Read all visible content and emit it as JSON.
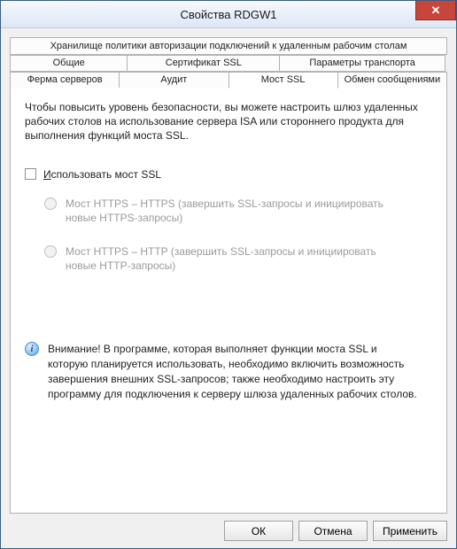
{
  "window": {
    "title": "Свойства RDGW1",
    "close_glyph": "✕"
  },
  "tabs": {
    "row1": [
      "Хранилище политики авторизации подключений к удаленным рабочим столам"
    ],
    "row2": [
      "Общие",
      "Сертификат SSL",
      "Параметры транспорта"
    ],
    "row3": [
      "Ферма серверов",
      "Аудит",
      "Мост SSL",
      "Обмен сообщениями"
    ],
    "active": "Мост SSL"
  },
  "panel": {
    "intro": "Чтобы повысить уровень безопасности, вы можете настроить шлюз удаленных рабочих столов на использование сервера ISA или стороннего продукта для выполнения функций моста SSL.",
    "checkbox": {
      "checked": false,
      "label_underline": "И",
      "label_rest": "спользовать мост SSL"
    },
    "radios": [
      {
        "label_underline": "М",
        "label_rest": "ост HTTPS – HTTPS (завершить SSL-запросы и инициировать новые HTTPS-запросы)"
      },
      {
        "label_underline": "М",
        "label_rest": "ост HTTPS – HTTP (завершить SSL-запросы и инициировать новые HTTP-запросы)"
      }
    ],
    "info_glyph": "i",
    "info": "Внимание! В программе, которая выполняет функции моста SSL и которую планируется использовать, необходимо включить возможность завершения внешних SSL-запросов; также необходимо настроить эту программу для подключения к серверу шлюза удаленных рабочих столов."
  },
  "buttons": {
    "ok": "ОК",
    "cancel": "Отмена",
    "apply": "Применить"
  }
}
